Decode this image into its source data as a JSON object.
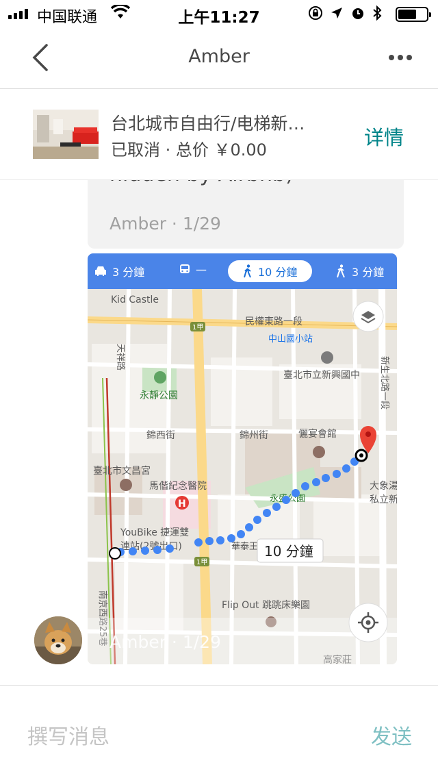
{
  "status_bar": {
    "carrier": "中国联通",
    "time": "上午11:27"
  },
  "nav": {
    "title": "Amber"
  },
  "listing": {
    "title": "台北城市自由行/电梯新…",
    "subtitle": "已取消 · 总价 ￥0.00",
    "details_label": "详情"
  },
  "previous_message": {
    "partial_text": "hidden by Airbnb)",
    "meta": "Amber · 1/29"
  },
  "map_message": {
    "modes": [
      {
        "icon": "car-icon",
        "label": "3 分鐘"
      },
      {
        "icon": "train-icon",
        "label": "—"
      },
      {
        "icon": "walk-icon",
        "label": "10 分鐘"
      },
      {
        "icon": "rideshare-icon",
        "label": "3 分鐘"
      }
    ],
    "route_label": "10 分鐘",
    "labels": {
      "kid_castle": "Kid Castle",
      "minquan": "民權東路一段",
      "zhongshan_station": "中山國小站",
      "school": "臺北市立新興國中",
      "yongjing_park": "永靜公園",
      "jinxi": "錦西街",
      "jinzhou": "錦州街",
      "banquet": "儷宴會館",
      "wenchang": "臺北市文昌宮",
      "mackay": "馬偕紀念醫院",
      "yongsheng_park": "永盛公園",
      "dax1": "大象湯",
      "dax2": "私立新",
      "youbike1": "YouBike 捷運雙",
      "youbike2": "連站(2號出口)",
      "huatai": "華泰王",
      "flipout": "Flip Out 跳跳床樂園",
      "gaojia": "高家莊",
      "tianxiang": "天祥路",
      "xinsheng": "新生北路一段",
      "nanjing": "南京西路25巷",
      "road_1a": "1甲",
      "road_1a2": "1甲"
    },
    "meta": "Amber · 1/29",
    "colors": {
      "route": "#4285f4",
      "pin": "#ea4335",
      "header": "#4a84e8"
    }
  },
  "compose": {
    "placeholder": "撰写消息",
    "send_label": "发送"
  }
}
